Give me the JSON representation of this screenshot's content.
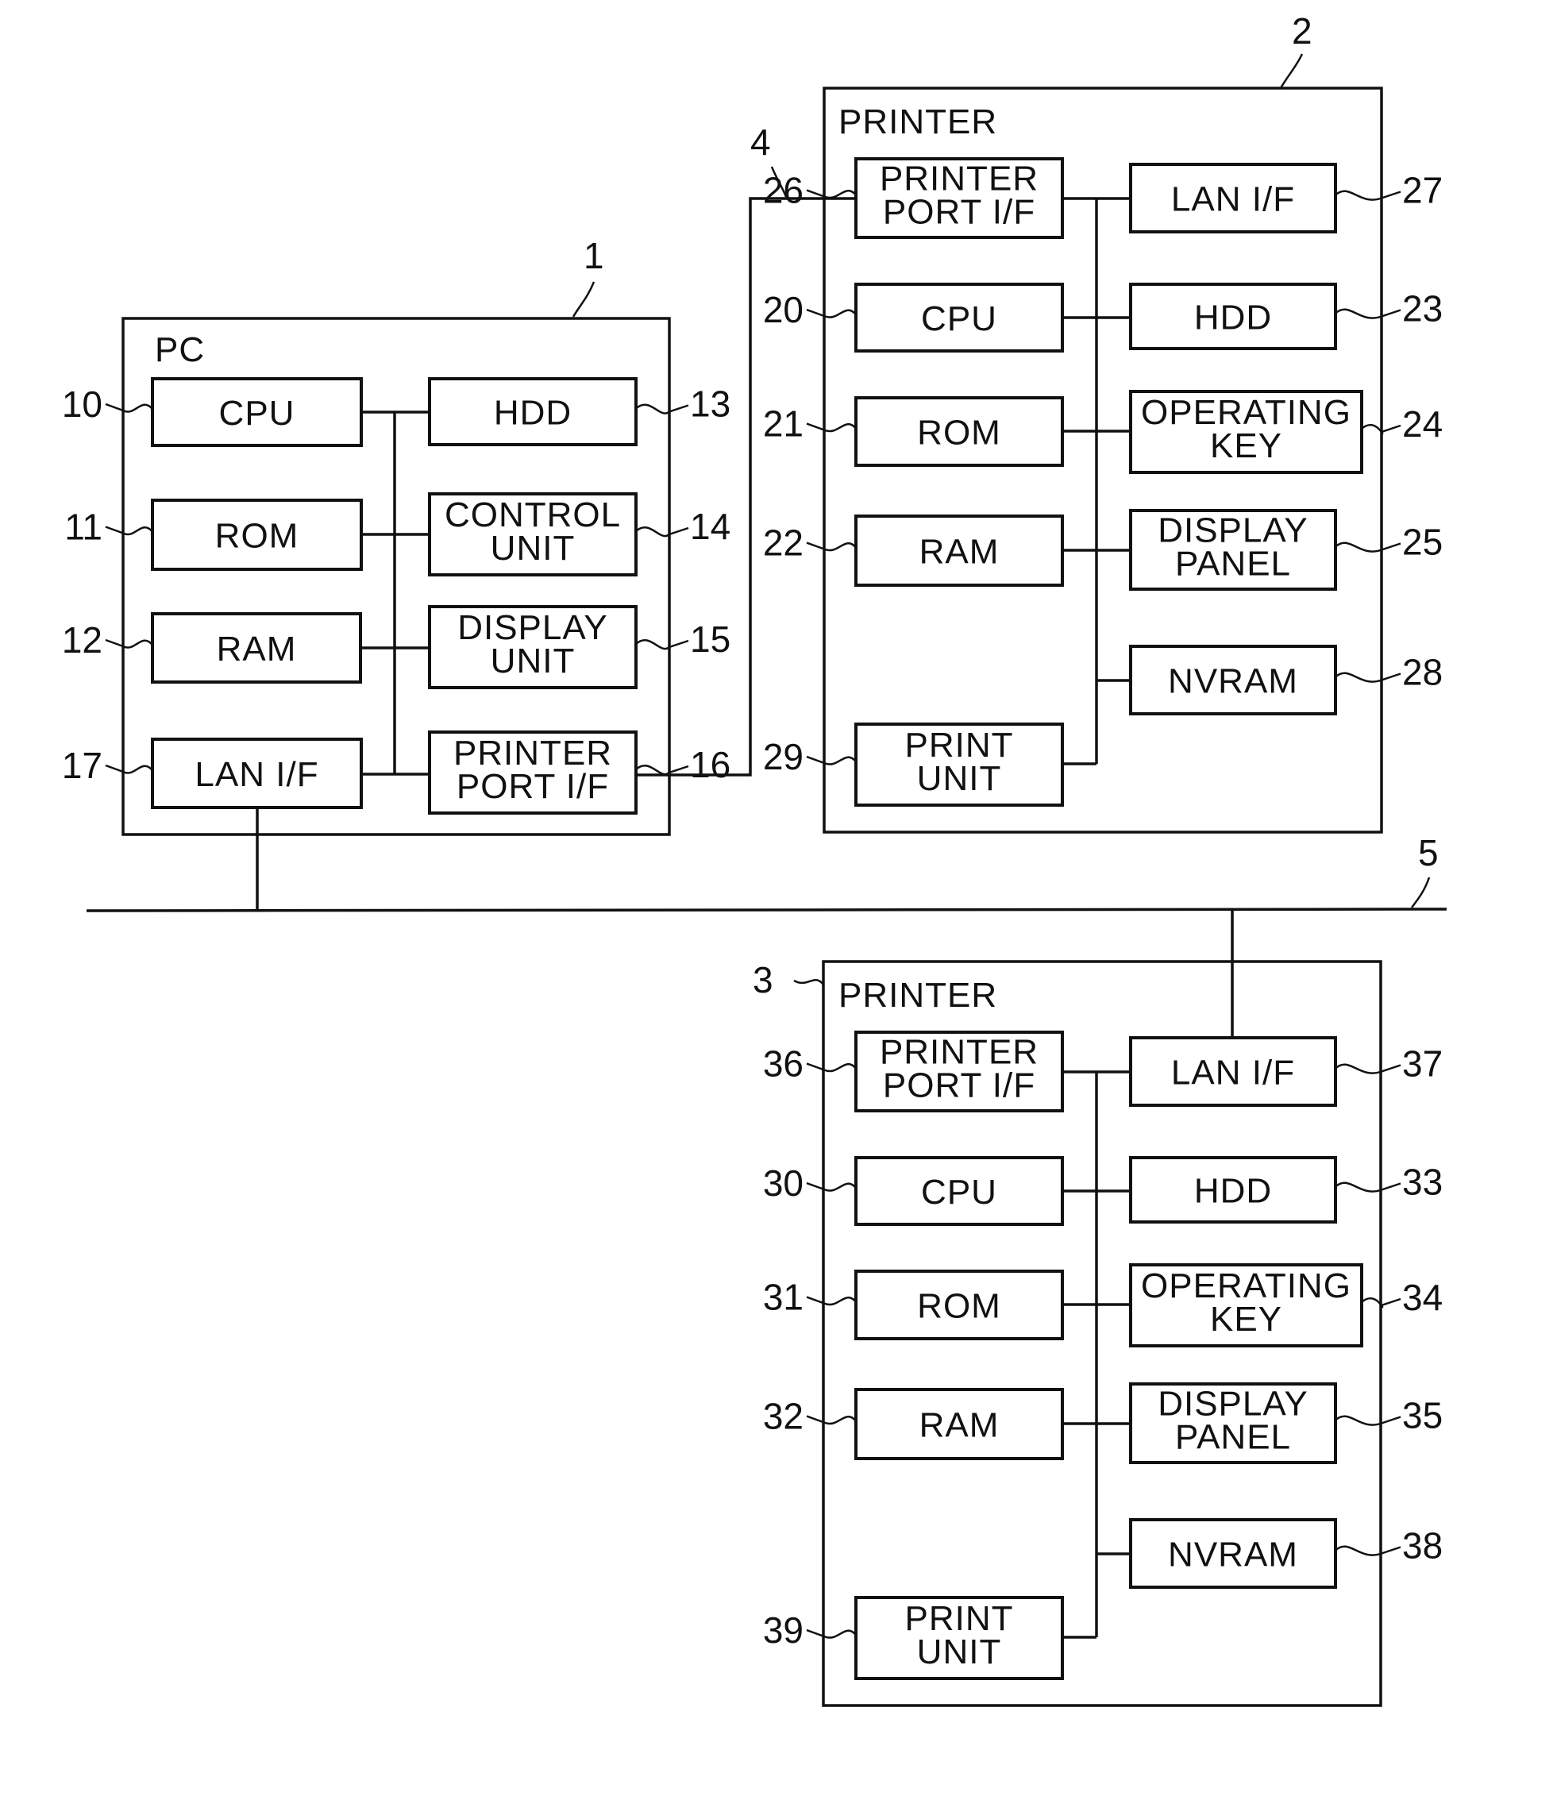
{
  "figure": {
    "pc": {
      "ref": "1",
      "title": "PC",
      "components": {
        "cpu": {
          "ref": "10",
          "lines": [
            "CPU"
          ]
        },
        "rom": {
          "ref": "11",
          "lines": [
            "ROM"
          ]
        },
        "ram": {
          "ref": "12",
          "lines": [
            "RAM"
          ]
        },
        "hdd": {
          "ref": "13",
          "lines": [
            "HDD"
          ]
        },
        "control": {
          "ref": "14",
          "lines": [
            "CONTROL",
            "UNIT"
          ]
        },
        "display": {
          "ref": "15",
          "lines": [
            "DISPLAY",
            "UNIT"
          ]
        },
        "printer_port": {
          "ref": "16",
          "lines": [
            "PRINTER",
            "PORT I/F"
          ]
        },
        "lan": {
          "ref": "17",
          "lines": [
            "LAN I/F"
          ]
        }
      }
    },
    "printer_a": {
      "ref": "2",
      "title": "PRINTER",
      "components": {
        "printer_port": {
          "ref": "26",
          "lines": [
            "PRINTER",
            "PORT I/F"
          ]
        },
        "cpu": {
          "ref": "20",
          "lines": [
            "CPU"
          ]
        },
        "rom": {
          "ref": "21",
          "lines": [
            "ROM"
          ]
        },
        "ram": {
          "ref": "22",
          "lines": [
            "RAM"
          ]
        },
        "print_unit": {
          "ref": "29",
          "lines": [
            "PRINT",
            "UNIT"
          ]
        },
        "lan": {
          "ref": "27",
          "lines": [
            "LAN I/F"
          ]
        },
        "hdd": {
          "ref": "23",
          "lines": [
            "HDD"
          ]
        },
        "operating_key": {
          "ref": "24",
          "lines": [
            "OPERATING",
            "KEY"
          ]
        },
        "display_panel": {
          "ref": "25",
          "lines": [
            "DISPLAY",
            "PANEL"
          ]
        },
        "nvram": {
          "ref": "28",
          "lines": [
            "NVRAM"
          ]
        }
      }
    },
    "printer_b": {
      "ref": "3",
      "title": "PRINTER",
      "components": {
        "printer_port": {
          "ref": "36",
          "lines": [
            "PRINTER",
            "PORT I/F"
          ]
        },
        "cpu": {
          "ref": "30",
          "lines": [
            "CPU"
          ]
        },
        "rom": {
          "ref": "31",
          "lines": [
            "ROM"
          ]
        },
        "ram": {
          "ref": "32",
          "lines": [
            "RAM"
          ]
        },
        "print_unit": {
          "ref": "39",
          "lines": [
            "PRINT",
            "UNIT"
          ]
        },
        "lan": {
          "ref": "37",
          "lines": [
            "LAN I/F"
          ]
        },
        "hdd": {
          "ref": "33",
          "lines": [
            "HDD"
          ]
        },
        "operating_key": {
          "ref": "34",
          "lines": [
            "OPERATING",
            "KEY"
          ]
        },
        "display_panel": {
          "ref": "35",
          "lines": [
            "DISPLAY",
            "PANEL"
          ]
        },
        "nvram": {
          "ref": "38",
          "lines": [
            "NVRAM"
          ]
        }
      }
    },
    "printer_cable": {
      "ref": "4"
    },
    "lan_network": {
      "ref": "5"
    }
  }
}
